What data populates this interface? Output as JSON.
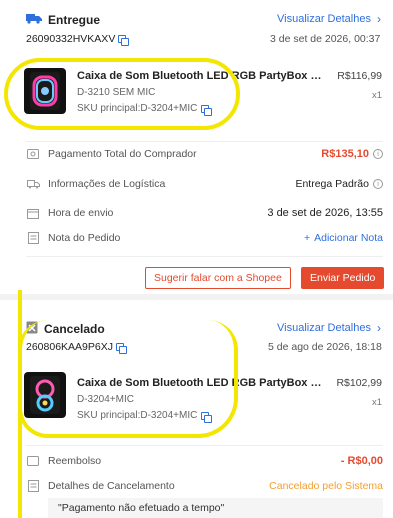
{
  "order1": {
    "status": "Entregue",
    "details_link": "Visualizar Detalhes",
    "order_id": "26090332HVKAXV",
    "date": "3 de set de 2026, 00:37",
    "product": {
      "title": "Caixa de Som Bluetooth LED RGB PartyBox W...",
      "variation": "D-3210 SEM MIC",
      "sku": "SKU principal:D-3204+MIC",
      "price": "R$116,99",
      "qty": "x1"
    },
    "rows": [
      {
        "label": "Pagamento Total do Comprador",
        "value": "R$135,10",
        "icon": "wallet-icon"
      },
      {
        "label": "Informações de Logística",
        "value": "Entrega Padrão",
        "icon": "truck-icon"
      },
      {
        "label": "Hora de envio",
        "value": "3 de set de 2026, 13:55",
        "icon": "calendar-icon"
      },
      {
        "label": "Nota do Pedido",
        "value": "Adicionar Nota",
        "icon": "note-icon"
      }
    ],
    "btn_contact": "Sugerir falar com a Shopee",
    "btn_send": "Enviar Pedido"
  },
  "order2": {
    "status": "Cancelado",
    "details_link": "Visualizar Detalhes",
    "order_id": "260806KAA9P6XJ",
    "date": "5 de ago de 2026, 18:18",
    "product": {
      "title": "Caixa de Som Bluetooth LED RGB PartyBox W...",
      "variation": "D-3204+MIC",
      "sku": "SKU principal:D-3204+MIC",
      "price": "R$102,99",
      "qty": "x1"
    },
    "rows": [
      {
        "label": "Reembolso",
        "value": "- R$0,00",
        "icon": "refund-icon"
      },
      {
        "label": "Detalhes de Cancelamento",
        "value": "Cancelado pelo Sistema",
        "icon": "document-icon"
      }
    ],
    "cancel_reason": "\"Pagamento não efetuado a tempo\""
  },
  "colors": {
    "accent": "#e54a2f",
    "link": "#2f6fdc",
    "highlight": "#f3e600",
    "cancel_status": "#f0a030"
  }
}
